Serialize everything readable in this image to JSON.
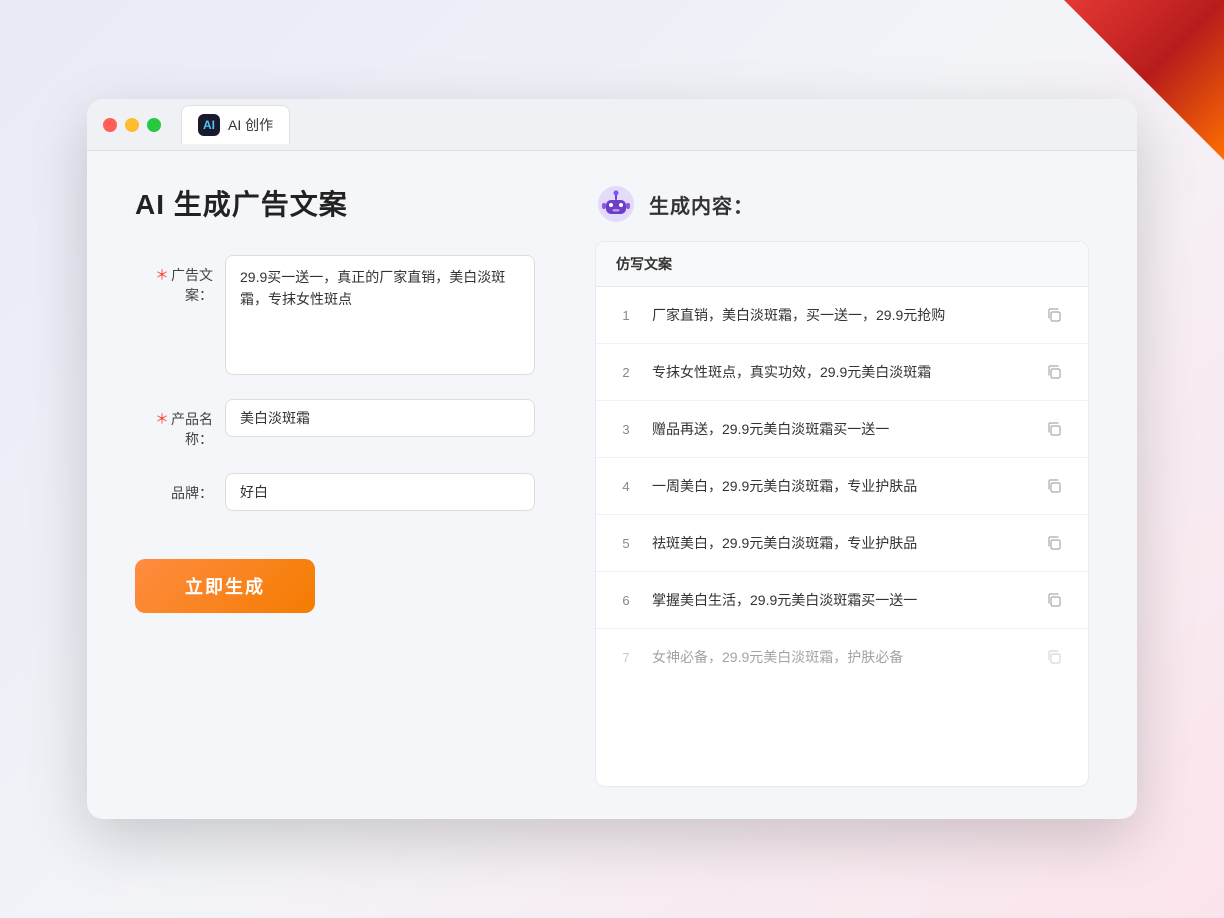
{
  "window": {
    "tab_icon_text": "AI",
    "tab_label": "AI 创作"
  },
  "left": {
    "page_title": "AI 生成广告文案",
    "form": {
      "ad_copy_label": "广告文案：",
      "ad_copy_required": "✱",
      "ad_copy_value": "29.9买一送一，真正的厂家直销，美白淡斑霜，专抹女性斑点",
      "product_name_label": "产品名称：",
      "product_name_required": "✱",
      "product_name_value": "美白淡斑霜",
      "brand_label": "品牌：",
      "brand_value": "好白",
      "generate_btn": "立即生成"
    }
  },
  "right": {
    "header": {
      "title": "生成内容："
    },
    "table": {
      "column_header": "仿写文案",
      "rows": [
        {
          "num": "1",
          "text": "厂家直销，美白淡斑霜，买一送一，29.9元抢购",
          "dimmed": false
        },
        {
          "num": "2",
          "text": "专抹女性斑点，真实功效，29.9元美白淡斑霜",
          "dimmed": false
        },
        {
          "num": "3",
          "text": "赠品再送，29.9元美白淡斑霜买一送一",
          "dimmed": false
        },
        {
          "num": "4",
          "text": "一周美白，29.9元美白淡斑霜，专业护肤品",
          "dimmed": false
        },
        {
          "num": "5",
          "text": "祛斑美白，29.9元美白淡斑霜，专业护肤品",
          "dimmed": false
        },
        {
          "num": "6",
          "text": "掌握美白生活，29.9元美白淡斑霜买一送一",
          "dimmed": false
        },
        {
          "num": "7",
          "text": "女神必备，29.9元美白淡斑霜，护肤必备",
          "dimmed": true
        }
      ]
    }
  }
}
